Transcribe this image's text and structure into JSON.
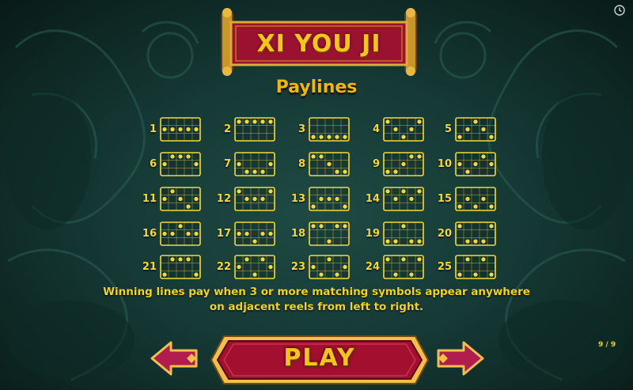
{
  "game": {
    "title": "XI YOU JI"
  },
  "page": {
    "heading": "Paylines",
    "indicator": "9 / 9"
  },
  "paylines": [
    {
      "num": "1",
      "rows": [
        1,
        1,
        1,
        1,
        1
      ]
    },
    {
      "num": "2",
      "rows": [
        0,
        0,
        0,
        0,
        0
      ]
    },
    {
      "num": "3",
      "rows": [
        2,
        2,
        2,
        2,
        2
      ]
    },
    {
      "num": "4",
      "rows": [
        0,
        1,
        2,
        1,
        0
      ]
    },
    {
      "num": "5",
      "rows": [
        2,
        1,
        0,
        1,
        2
      ]
    },
    {
      "num": "6",
      "rows": [
        1,
        0,
        0,
        0,
        1
      ]
    },
    {
      "num": "7",
      "rows": [
        1,
        2,
        2,
        2,
        1
      ]
    },
    {
      "num": "8",
      "rows": [
        0,
        0,
        1,
        2,
        2
      ]
    },
    {
      "num": "9",
      "rows": [
        2,
        2,
        1,
        0,
        0
      ]
    },
    {
      "num": "10",
      "rows": [
        1,
        2,
        1,
        0,
        1
      ]
    },
    {
      "num": "11",
      "rows": [
        1,
        0,
        1,
        2,
        1
      ]
    },
    {
      "num": "12",
      "rows": [
        0,
        1,
        1,
        1,
        0
      ]
    },
    {
      "num": "13",
      "rows": [
        2,
        1,
        1,
        1,
        2
      ]
    },
    {
      "num": "14",
      "rows": [
        0,
        1,
        0,
        1,
        0
      ]
    },
    {
      "num": "15",
      "rows": [
        2,
        1,
        2,
        1,
        2
      ]
    },
    {
      "num": "16",
      "rows": [
        1,
        1,
        0,
        1,
        1
      ]
    },
    {
      "num": "17",
      "rows": [
        1,
        1,
        2,
        1,
        1
      ]
    },
    {
      "num": "18",
      "rows": [
        0,
        0,
        2,
        0,
        0
      ]
    },
    {
      "num": "19",
      "rows": [
        2,
        2,
        0,
        2,
        2
      ]
    },
    {
      "num": "20",
      "rows": [
        0,
        2,
        2,
        2,
        0
      ]
    },
    {
      "num": "21",
      "rows": [
        2,
        0,
        0,
        0,
        2
      ]
    },
    {
      "num": "22",
      "rows": [
        1,
        0,
        2,
        0,
        1
      ]
    },
    {
      "num": "23",
      "rows": [
        1,
        2,
        0,
        2,
        1
      ]
    },
    {
      "num": "24",
      "rows": [
        0,
        2,
        0,
        2,
        0
      ]
    },
    {
      "num": "25",
      "rows": [
        2,
        0,
        2,
        0,
        2
      ]
    }
  ],
  "rules": {
    "line1": "Winning lines pay when 3 or more matching symbols appear anywhere",
    "line2": "on adjacent reels from left to right."
  },
  "buttons": {
    "play": "PLAY"
  },
  "colors": {
    "gold": "#f4d93a",
    "crimson": "#a0142e",
    "teal_bg": "#163a36"
  },
  "icons": {
    "clock": "clock-icon",
    "prev": "arrow-left-icon",
    "next": "arrow-right-icon"
  }
}
